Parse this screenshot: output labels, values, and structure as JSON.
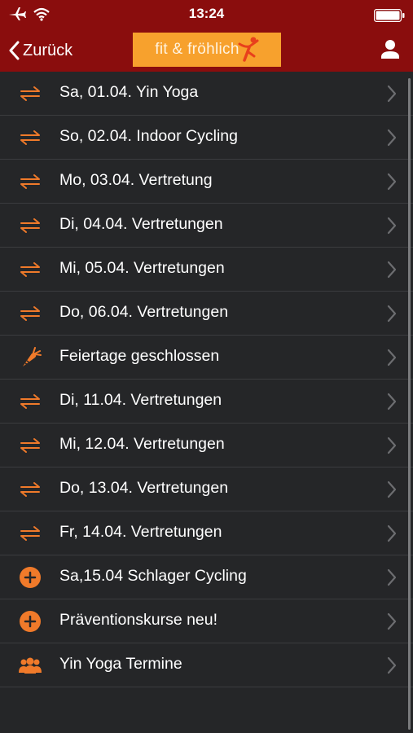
{
  "status": {
    "time": "13:24"
  },
  "nav": {
    "back_label": "Zurück",
    "logo_text": "fit & fröhlich"
  },
  "colors": {
    "accent": "#f07a2a",
    "navbar": "#8a0d0d",
    "background": "#252628",
    "logo_bg": "#f7a12d"
  },
  "items": [
    {
      "label": "Sa, 01.04. Yin Yoga",
      "icon": "swap-arrows-icon"
    },
    {
      "label": "So, 02.04. Indoor Cycling",
      "icon": "swap-arrows-icon"
    },
    {
      "label": "Mo, 03.04. Vertretung",
      "icon": "swap-arrows-icon"
    },
    {
      "label": "Di, 04.04. Vertretungen",
      "icon": "swap-arrows-icon"
    },
    {
      "label": "Mi, 05.04. Vertretungen",
      "icon": "swap-arrows-icon"
    },
    {
      "label": "Do, 06.04. Vertretungen",
      "icon": "swap-arrows-icon"
    },
    {
      "label": "Feiertage geschlossen",
      "icon": "carrot-icon"
    },
    {
      "label": "Di, 11.04. Vertretungen",
      "icon": "swap-arrows-icon"
    },
    {
      "label": "Mi, 12.04. Vertretungen",
      "icon": "swap-arrows-icon"
    },
    {
      "label": "Do, 13.04. Vertretungen",
      "icon": "swap-arrows-icon"
    },
    {
      "label": "Fr, 14.04. Vertretungen",
      "icon": "swap-arrows-icon"
    },
    {
      "label": "Sa,15.04 Schlager Cycling",
      "icon": "plus-circle-icon"
    },
    {
      "label": "Präventionskurse neu!",
      "icon": "plus-circle-icon"
    },
    {
      "label": "Yin Yoga Termine",
      "icon": "group-icon"
    }
  ]
}
